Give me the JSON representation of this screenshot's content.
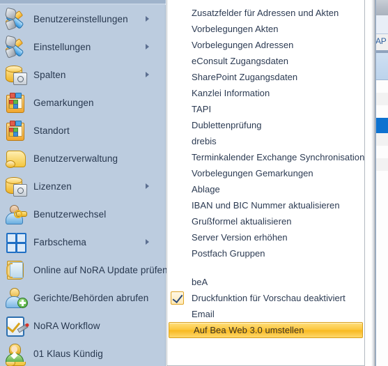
{
  "left_menu": {
    "items": [
      {
        "label": "Benutzereinstellungen",
        "icon": "tools-icon",
        "has_submenu": true
      },
      {
        "label": "Einstellungen",
        "icon": "tools-icon",
        "has_submenu": true
      },
      {
        "label": "Spalten",
        "icon": "database-icon",
        "has_submenu": true
      },
      {
        "label": "Gemarkungen",
        "icon": "notebook-icon",
        "has_submenu": false
      },
      {
        "label": "Standort",
        "icon": "notebook-icon",
        "has_submenu": false
      },
      {
        "label": "Benutzerverwaltung",
        "icon": "scroll-icon",
        "has_submenu": false
      },
      {
        "label": "Lizenzen",
        "icon": "database-icon",
        "has_submenu": true
      },
      {
        "label": "Benutzerwechsel",
        "icon": "user-key-icon",
        "has_submenu": false
      },
      {
        "label": "Farbschema",
        "icon": "color-scheme-icon",
        "has_submenu": true
      },
      {
        "label": "Online auf NoRA Update prüfen",
        "icon": "book-update-icon",
        "has_submenu": false
      },
      {
        "label": "Gerichte/Behörden abrufen",
        "icon": "user-plus-icon",
        "has_submenu": false
      },
      {
        "label": "NoRA Workflow",
        "icon": "workflow-icon",
        "has_submenu": false
      },
      {
        "label": "01 Klaus  Kündig",
        "icon": "person-icon",
        "has_submenu": false
      }
    ]
  },
  "right_menu": {
    "items": [
      {
        "label": "Zusatzfelder für Adressen und Akten",
        "checked": false,
        "highlighted": false
      },
      {
        "label": "Vorbelegungen Akten",
        "checked": false,
        "highlighted": false
      },
      {
        "label": "Vorbelegungen Adressen",
        "checked": false,
        "highlighted": false
      },
      {
        "label": "eConsult Zugangsdaten",
        "checked": false,
        "highlighted": false
      },
      {
        "label": "SharePoint Zugangsdaten",
        "checked": false,
        "highlighted": false
      },
      {
        "label": "Kanzlei Information",
        "checked": false,
        "highlighted": false
      },
      {
        "label": "TAPI",
        "checked": false,
        "highlighted": false
      },
      {
        "label": "Dublettenprüfung",
        "checked": false,
        "highlighted": false
      },
      {
        "label": "drebis",
        "checked": false,
        "highlighted": false
      },
      {
        "label": "Terminkalender Exchange Synchronisation",
        "checked": false,
        "highlighted": false
      },
      {
        "label": "Vorbelegungen Gemarkungen",
        "checked": false,
        "highlighted": false
      },
      {
        "label": "Ablage",
        "checked": false,
        "highlighted": false
      },
      {
        "label": "IBAN und BIC Nummer aktualisieren",
        "checked": false,
        "highlighted": false
      },
      {
        "label": "Grußformel aktualisieren",
        "checked": false,
        "highlighted": false
      },
      {
        "label": "Server Version erhöhen",
        "checked": false,
        "highlighted": false
      },
      {
        "label": "Postfach Gruppen",
        "checked": false,
        "highlighted": false
      },
      {
        "label": "",
        "separator": true
      },
      {
        "label": "beA",
        "checked": false,
        "highlighted": false
      },
      {
        "label": "Druckfunktion für Vorschau deaktiviert",
        "checked": true,
        "highlighted": false
      },
      {
        "label": "Email",
        "checked": false,
        "highlighted": false
      },
      {
        "label": "Auf Bea Web 3.0 umstellen",
        "checked": false,
        "highlighted": true
      }
    ]
  },
  "background_window": {
    "visible_tab_label": "AP"
  },
  "colors": {
    "left_menu_background": "#bcccdf",
    "right_menu_background": "#ffffff",
    "menu_text": "#2b3a52",
    "highlight_amber": "#fcc63c",
    "checkbox_border": "#e0a424",
    "submenu_arrow": "#5c6f91",
    "background_selection_blue": "#0d72d0"
  }
}
